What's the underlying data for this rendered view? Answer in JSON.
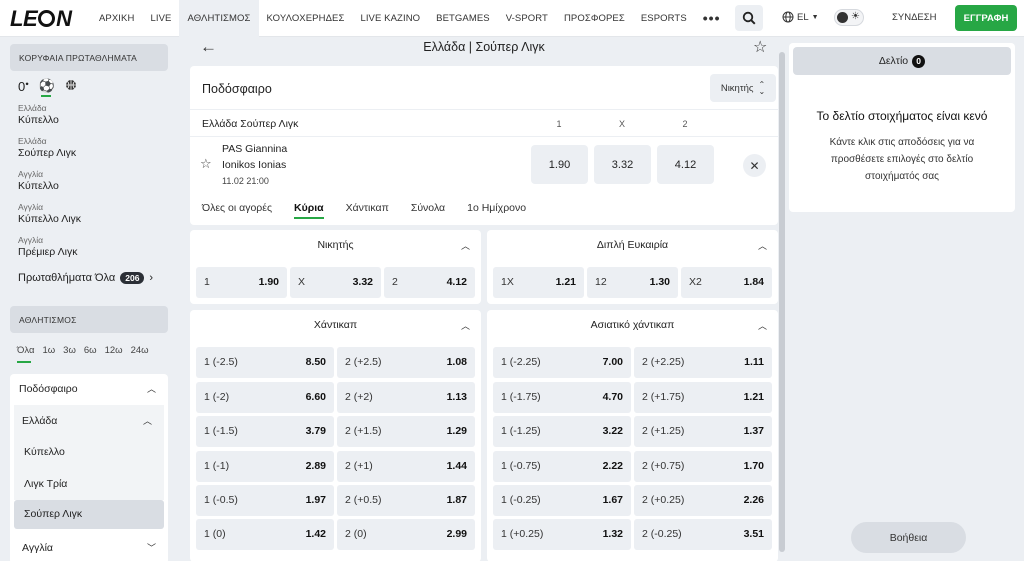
{
  "header": {
    "logo": {
      "pre": "LE",
      "post": "N"
    },
    "nav": [
      "ΑΡΧΙΚΗ",
      "LIVE",
      "ΑΘΛΗΤΙΣΜΟΣ",
      "ΚΟΥΛΟΧΕΡΗΔΕΣ",
      "LIVE ΚΑΖΙΝΟ",
      "BETGAMES",
      "V-SPORT",
      "ΠΡΟΣΦΟΡΕΣ",
      "ESPORTS"
    ],
    "more": "•••",
    "language": "EL",
    "login": "ΣΥΝΔΕΣΗ",
    "register": "ΕΓΓΡΑΦΗ",
    "accent": "#27a745"
  },
  "sidebar": {
    "top_leagues_title": "ΚΟΡΥΦΑΙΑ ΠΡΩΤΑΘΛΗΜΑΤΑ",
    "live_count": "0",
    "leagues": [
      {
        "country": "Ελλάδα",
        "name": "Κύπελλο"
      },
      {
        "country": "Ελλάδα",
        "name": "Σούπερ Λιγκ"
      },
      {
        "country": "Αγγλία",
        "name": "Κύπελλο"
      },
      {
        "country": "Αγγλία",
        "name": "Κύπελλο Λιγκ"
      },
      {
        "country": "Αγγλία",
        "name": "Πρέμιερ Λιγκ"
      }
    ],
    "all_leagues": "Πρωταθλήματα Όλα",
    "all_leagues_count": "206",
    "sports_title": "ΑΘΛΗΤΙΣΜΟΣ",
    "time_filters": [
      "Όλα",
      "1ω",
      "3ω",
      "6ω",
      "12ω",
      "24ω"
    ],
    "sport": "Ποδόσφαιρο",
    "country": "Ελλάδα",
    "country_leagues": [
      "Κύπελλο",
      "Λιγκ Τρία",
      "Σούπερ Λιγκ"
    ],
    "next_country": "Αγγλία"
  },
  "main": {
    "title": "Ελλάδα | Σούπερ Λιγκ",
    "sport_title": "Ποδόσφαιρο",
    "winner_dropdown": "Νικητής",
    "league_name": "Ελλάδα Σούπερ Λιγκ",
    "columns": [
      "1",
      "X",
      "2"
    ],
    "match": {
      "home": "PAS Giannina",
      "away": "Ionikos Ionias",
      "date": "11.02",
      "time": "21:00",
      "odds": [
        "1.90",
        "3.32",
        "4.12"
      ]
    },
    "tabs": [
      "Όλες οι αγορές",
      "Κύρια",
      "Χάντικαπ",
      "Σύνολα",
      "1ο Ημίχρονο"
    ],
    "active_tab": "Κύρια",
    "markets": {
      "winner": {
        "title": "Νικητής",
        "odds": [
          {
            "label": "1",
            "value": "1.90"
          },
          {
            "label": "X",
            "value": "3.32"
          },
          {
            "label": "2",
            "value": "4.12"
          }
        ]
      },
      "double_chance": {
        "title": "Διπλή Ευκαιρία",
        "odds": [
          {
            "label": "1X",
            "value": "1.21"
          },
          {
            "label": "12",
            "value": "1.30"
          },
          {
            "label": "X2",
            "value": "1.84"
          }
        ]
      },
      "handicap": {
        "title": "Χάντικαπ",
        "rows": [
          [
            {
              "label": "1 (-2.5)",
              "value": "8.50"
            },
            {
              "label": "2 (+2.5)",
              "value": "1.08"
            }
          ],
          [
            {
              "label": "1 (-2)",
              "value": "6.60"
            },
            {
              "label": "2 (+2)",
              "value": "1.13"
            }
          ],
          [
            {
              "label": "1 (-1.5)",
              "value": "3.79"
            },
            {
              "label": "2 (+1.5)",
              "value": "1.29"
            }
          ],
          [
            {
              "label": "1 (-1)",
              "value": "2.89"
            },
            {
              "label": "2 (+1)",
              "value": "1.44"
            }
          ],
          [
            {
              "label": "1 (-0.5)",
              "value": "1.97"
            },
            {
              "label": "2 (+0.5)",
              "value": "1.87"
            }
          ],
          [
            {
              "label": "1 (0)",
              "value": "1.42"
            },
            {
              "label": "2 (0)",
              "value": "2.99"
            }
          ]
        ]
      },
      "asian_handicap": {
        "title": "Ασιατικό χάντικαπ",
        "rows": [
          [
            {
              "label": "1 (-2.25)",
              "value": "7.00"
            },
            {
              "label": "2 (+2.25)",
              "value": "1.11"
            }
          ],
          [
            {
              "label": "1 (-1.75)",
              "value": "4.70"
            },
            {
              "label": "2 (+1.75)",
              "value": "1.21"
            }
          ],
          [
            {
              "label": "1 (-1.25)",
              "value": "3.22"
            },
            {
              "label": "2 (+1.25)",
              "value": "1.37"
            }
          ],
          [
            {
              "label": "1 (-0.75)",
              "value": "2.22"
            },
            {
              "label": "2 (+0.75)",
              "value": "1.70"
            }
          ],
          [
            {
              "label": "1 (-0.25)",
              "value": "1.67"
            },
            {
              "label": "2 (+0.25)",
              "value": "2.26"
            }
          ],
          [
            {
              "label": "1 (+0.25)",
              "value": "1.32"
            },
            {
              "label": "2 (-0.25)",
              "value": "3.51"
            }
          ]
        ]
      }
    }
  },
  "betslip": {
    "tab_label": "Δελτίο",
    "count": "0",
    "empty_title": "Το δελτίο στοιχήματος είναι κενό",
    "empty_desc": "Κάντε κλικ στις αποδόσεις για να προσθέσετε επιλογές στο δελτίο στοιχήματός σας",
    "help": "Βοήθεια"
  }
}
